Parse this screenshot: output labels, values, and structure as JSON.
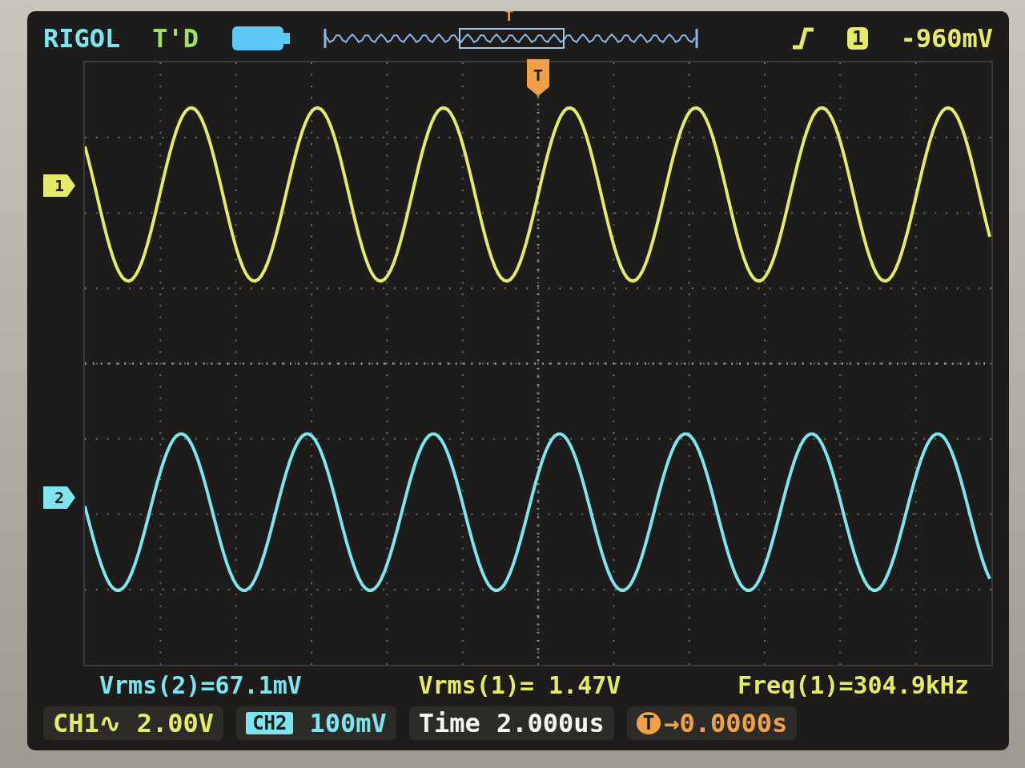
{
  "header": {
    "brand": "RIGOL",
    "status": "T'D",
    "trigger_marker": "T",
    "trigger_source": "1",
    "trigger_level": "-960mV"
  },
  "channels": [
    {
      "marker": "1",
      "color": "#e6ea6a"
    },
    {
      "marker": "2",
      "color": "#7ee4ee"
    }
  ],
  "grid_trigger_marker": "T",
  "measurements": [
    {
      "text": "Vrms(2)=67.1mV",
      "color": "#7ee4ee"
    },
    {
      "text": "Vrms(1)= 1.47V",
      "color": "#e6ea6a"
    },
    {
      "text": "Freq(1)=304.9kHz",
      "color": "#e6ea6a"
    }
  ],
  "status_bar": {
    "ch1_label": "CH1∿",
    "ch1_scale": "2.00V",
    "ch2_label": "CH2",
    "ch2_scale": "100mV",
    "time_label": "Time",
    "time_value": "2.000us",
    "offset_icon": "T",
    "offset_value": "→0.0000s"
  }
}
